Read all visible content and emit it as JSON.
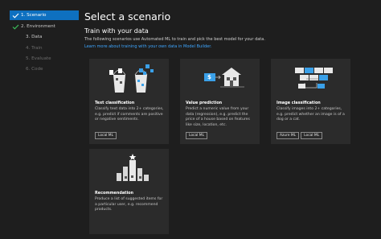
{
  "sidebar": {
    "steps": [
      {
        "label": "1. Scenario",
        "state": "active"
      },
      {
        "label": "2. Environment",
        "state": "done"
      },
      {
        "label": "3. Data",
        "state": "normal"
      },
      {
        "label": "4. Train",
        "state": "disabled"
      },
      {
        "label": "5. Evaluate",
        "state": "disabled"
      },
      {
        "label": "6. Code",
        "state": "disabled"
      }
    ]
  },
  "main": {
    "title": "Select a scenario",
    "subtitle": "Train with your data",
    "description": "The following scenarios use Automated ML to train and pick the best model for your data.",
    "link": "Learn more about training with your own data in Model Builder."
  },
  "cards": [
    {
      "title": "Text classification",
      "description": "Classify text data into 2+ categories, e.g. predict if comments are positive or negative sentiments.",
      "tags": [
        "Local ML"
      ],
      "illustration": "text-classification-icon"
    },
    {
      "title": "Value prediction",
      "description": "Predict a numeric value from your data (regression), e.g. predict the price of a house based on features like size, location, etc.",
      "tags": [
        "Local ML"
      ],
      "illustration": "value-prediction-icon"
    },
    {
      "title": "Image classification",
      "description": "Classify images into 2+ categories, e.g. predict whether an image is of a dog or a cat.",
      "tags": [
        "Azure ML",
        "Local ML"
      ],
      "illustration": "image-classification-icon"
    },
    {
      "title": "Recommendation",
      "description": "Produce a list of suggested items for a particular user, e.g. recommend products.",
      "tags": [],
      "illustration": "recommendation-icon"
    }
  ],
  "colors": {
    "accent": "#0e70c0",
    "link": "#3ea6ff",
    "check": "#3cbf5a"
  },
  "illustration_text": {
    "price": "$"
  }
}
